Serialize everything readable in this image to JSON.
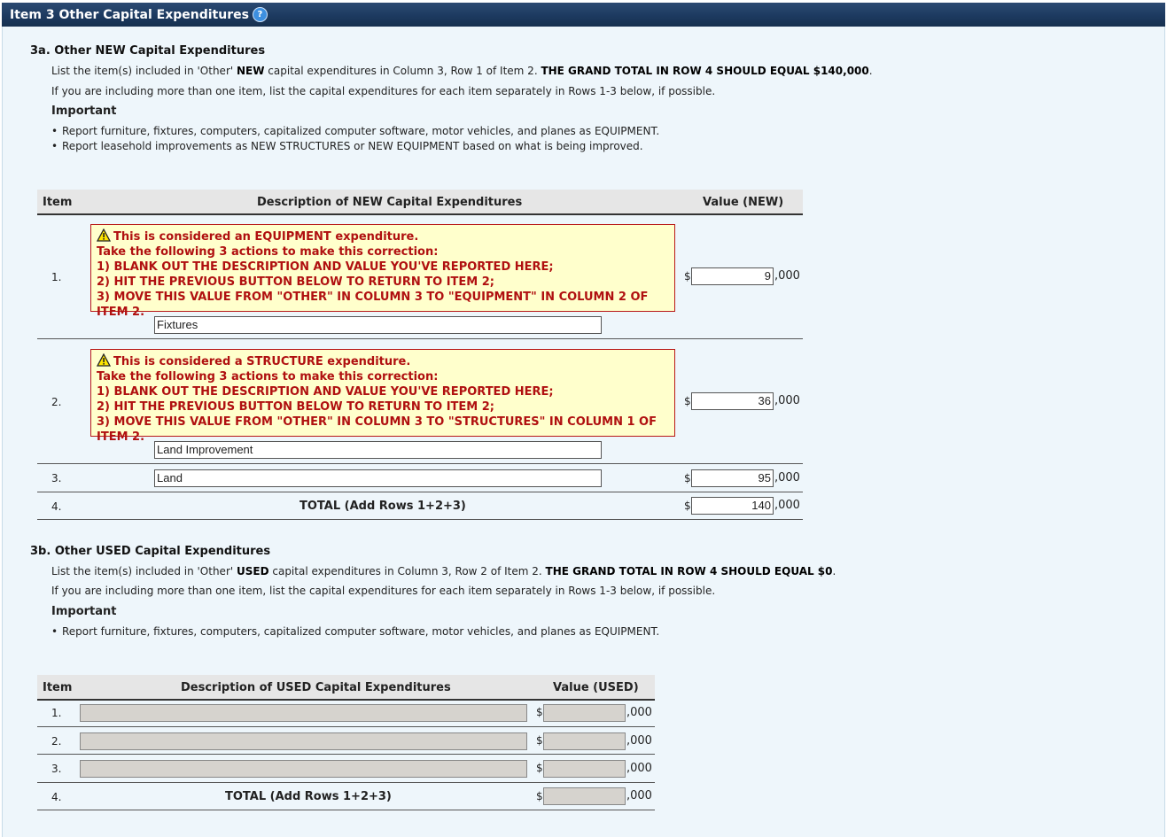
{
  "header": {
    "title": "Item 3 Other Capital Expenditures",
    "help_icon": "?"
  },
  "section_a": {
    "heading": "3a. Other NEW Capital Expenditures",
    "line1_pre": "List the item(s) included in 'Other' ",
    "line1_bold": "NEW",
    "line1_mid": " capital expenditures in Column 3, Row 1 of Item 2. ",
    "line1_grand": "THE GRAND TOTAL IN ROW 4 SHOULD EQUAL $140,000",
    "line1_end": ".",
    "line2": "If you are including more than one item, list the capital expenditures for each item separately in Rows 1-3 below, if possible.",
    "important": "Important",
    "bullets": [
      "Report furniture, fixtures, computers, capitalized computer software, motor vehicles, and planes as EQUIPMENT.",
      "Report leasehold improvements as NEW STRUCTURES or NEW EQUIPMENT based on what is being improved."
    ],
    "table": {
      "col_item": "Item",
      "col_desc": "Description of NEW Capital Expenditures",
      "col_value": "Value (NEW)",
      "rows": [
        {
          "num": "1.",
          "warning": [
            "This is considered an EQUIPMENT expenditure.",
            "Take the following 3 actions to make this correction:",
            "1) BLANK OUT THE DESCRIPTION AND VALUE YOU'VE REPORTED HERE;",
            "2) HIT THE PREVIOUS BUTTON BELOW TO RETURN TO ITEM 2;",
            "3) MOVE THIS VALUE FROM \"OTHER\" IN COLUMN 3 TO \"EQUIPMENT\" IN COLUMN 2 OF ITEM 2."
          ],
          "description": "Fixtures",
          "value": "9"
        },
        {
          "num": "2.",
          "warning": [
            "This is considered a STRUCTURE expenditure.",
            "Take the following 3 actions to make this correction:",
            "1) BLANK OUT THE DESCRIPTION AND VALUE YOU'VE REPORTED HERE;",
            "2) HIT THE PREVIOUS BUTTON BELOW TO RETURN TO ITEM 2;",
            "3) MOVE THIS VALUE FROM \"OTHER\" IN COLUMN 3 TO \"STRUCTURES\" IN COLUMN 1 OF ITEM 2."
          ],
          "description": "Land Improvement",
          "value": "36"
        },
        {
          "num": "3.",
          "description": "Land",
          "value": "95"
        }
      ],
      "total": {
        "num": "4.",
        "label": "TOTAL (Add Rows 1+2+3)",
        "value": "140"
      },
      "currency": "$",
      "thousands": ",000"
    }
  },
  "section_b": {
    "heading": "3b. Other USED Capital Expenditures",
    "line1_pre": "List the item(s) included in 'Other' ",
    "line1_bold": "USED",
    "line1_mid": " capital expenditures in Column 3, Row 2 of Item 2. ",
    "line1_grand": "THE GRAND TOTAL IN ROW 4 SHOULD EQUAL $0",
    "line1_end": ".",
    "line2": "If you are including more than one item, list the capital expenditures for each item separately in Rows 1-3 below, if possible.",
    "important": "Important",
    "bullets": [
      "Report furniture, fixtures, computers, capitalized computer software, motor vehicles, and planes as EQUIPMENT."
    ],
    "table": {
      "col_item": "Item",
      "col_desc": "Description of USED Capital Expenditures",
      "col_value": "Value (USED)",
      "rows": [
        {
          "num": "1.",
          "description": "",
          "value": ""
        },
        {
          "num": "2.",
          "description": "",
          "value": ""
        },
        {
          "num": "3.",
          "description": "",
          "value": ""
        }
      ],
      "total": {
        "num": "4.",
        "label": "TOTAL (Add Rows 1+2+3)",
        "value": ""
      },
      "currency": "$",
      "thousands": ",000"
    }
  }
}
